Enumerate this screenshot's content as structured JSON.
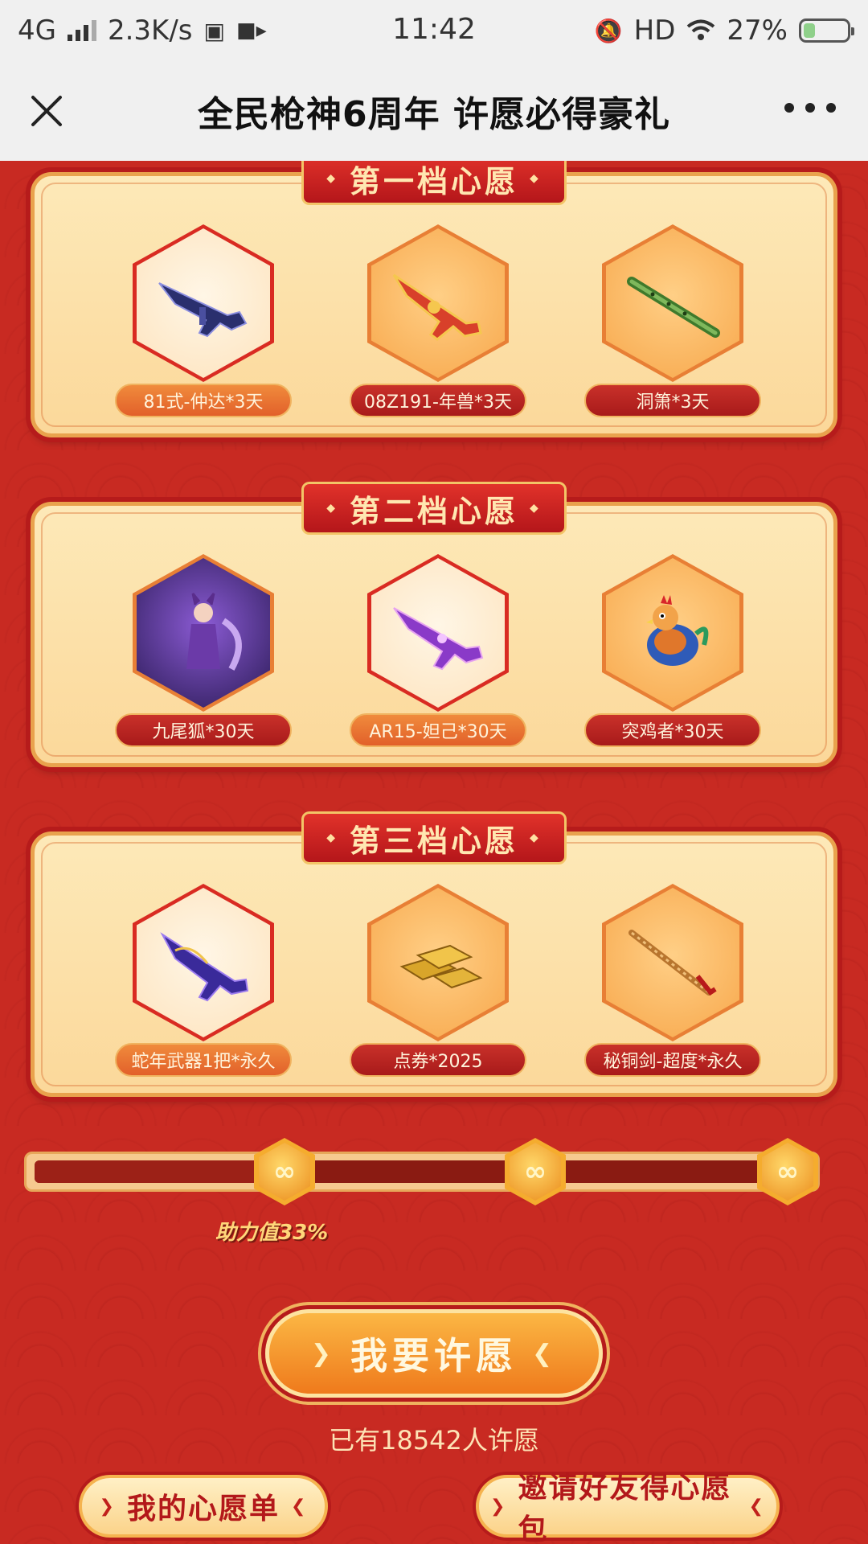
{
  "status_bar": {
    "network": "4G",
    "speed": "2.3K/s",
    "time": "11:42",
    "hd": "HD",
    "battery": "27%",
    "battery_level": 0.27
  },
  "title_bar": {
    "title": "全民枪神6周年 许愿必得豪礼"
  },
  "tiers": [
    {
      "title": "第一档心愿",
      "rewards": [
        {
          "label": "81式-仲达*3天",
          "icon": "rifle-icon",
          "featured": true
        },
        {
          "label": "08Z191-年兽*3天",
          "icon": "golden-rifle-icon",
          "featured": false
        },
        {
          "label": "洞箫*3天",
          "icon": "flute-icon",
          "featured": false
        }
      ]
    },
    {
      "title": "第二档心愿",
      "rewards": [
        {
          "label": "九尾狐*30天",
          "icon": "fox-character-icon",
          "featured": false
        },
        {
          "label": "AR15-妲己*30天",
          "icon": "purple-rifle-icon",
          "featured": true
        },
        {
          "label": "突鸡者*30天",
          "icon": "rooster-icon",
          "featured": false
        }
      ]
    },
    {
      "title": "第三档心愿",
      "rewards": [
        {
          "label": "蛇年武器1把*永久",
          "icon": "snake-rifle-icon",
          "featured": true
        },
        {
          "label": "点券*2025",
          "icon": "gold-coupon-icon",
          "featured": false
        },
        {
          "label": "秘铜剑-超度*永久",
          "icon": "sword-icon",
          "featured": false
        }
      ]
    }
  ],
  "progress": {
    "label": "助力值33%",
    "value": 0.33,
    "milestones": 3
  },
  "wish_button": {
    "label": "我要许愿"
  },
  "wish_count": "已有18542人许愿",
  "bottom_buttons": {
    "wishlist": "我的心愿单",
    "invite": "邀请好友得心愿包"
  },
  "colors": {
    "background_red": "#c82a22",
    "panel_cream": "#fde9b8",
    "accent_orange": "#ef7a1c",
    "title_gold": "#ffe7b1"
  }
}
